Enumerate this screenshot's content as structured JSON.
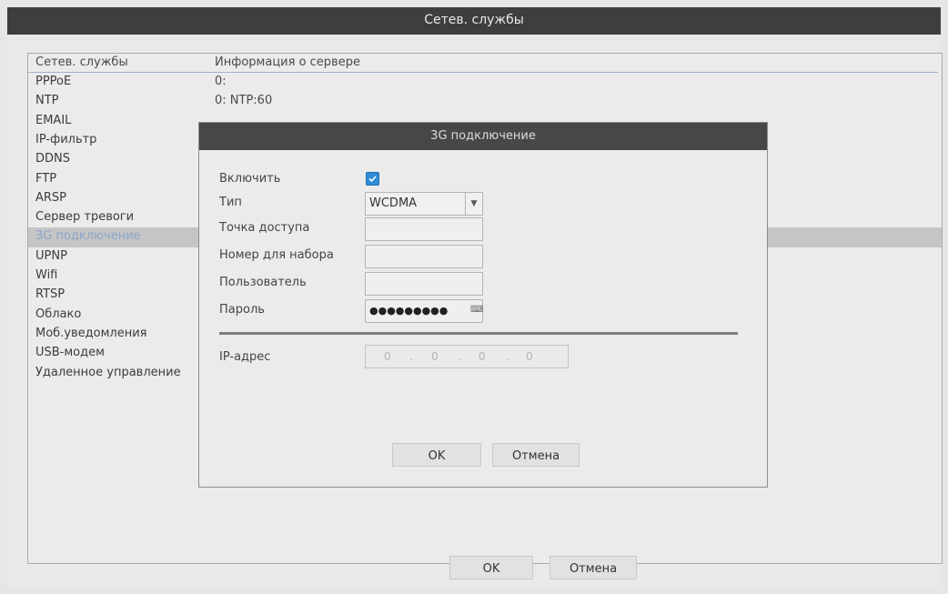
{
  "window": {
    "title": "Сетев. службы"
  },
  "list": {
    "headers": [
      "Сетев. службы",
      "Информация о сервере"
    ],
    "rows": [
      {
        "name": "PPPoE",
        "info": "0:"
      },
      {
        "name": "NTP",
        "info": "0: NTP:60"
      },
      {
        "name": "EMAIL",
        "info": ""
      },
      {
        "name": "IP-фильтр",
        "info": ""
      },
      {
        "name": "DDNS",
        "info": ""
      },
      {
        "name": "FTP",
        "info": ""
      },
      {
        "name": "ARSP",
        "info": ""
      },
      {
        "name": "Сервер тревоги",
        "info": ""
      },
      {
        "name": "3G подключение",
        "info": ""
      },
      {
        "name": "UPNP",
        "info": ""
      },
      {
        "name": "Wifi",
        "info": ""
      },
      {
        "name": "RTSP",
        "info": ""
      },
      {
        "name": "Облако",
        "info": ""
      },
      {
        "name": "Моб.уведомления",
        "info": ""
      },
      {
        "name": "USB-модем",
        "info": ""
      },
      {
        "name": "Удаленное управление",
        "info": ""
      }
    ],
    "selected_index": 8
  },
  "buttons": {
    "ok": "OK",
    "cancel": "Отмена"
  },
  "dialog": {
    "title": "3G подключение",
    "enable_label": "Включить",
    "enabled": true,
    "type_label": "Тип",
    "type_value": "WCDMA",
    "apn_label": "Точка доступа",
    "apn_value": "",
    "dial_label": "Номер для набора",
    "dial_value": "",
    "user_label": "Пользователь",
    "user_value": "",
    "password_label": "Пароль",
    "password_value": "●●●●●●●●●",
    "ip_label": "IP-адрес",
    "ip_octets": [
      "0",
      "0",
      "0",
      "0"
    ],
    "ok": "OK",
    "cancel": "Отмена"
  },
  "colors": {
    "titlebar": "#3e3e3e",
    "checkbox": "#2f8cd8",
    "selected_row": "#c5c5c5"
  }
}
